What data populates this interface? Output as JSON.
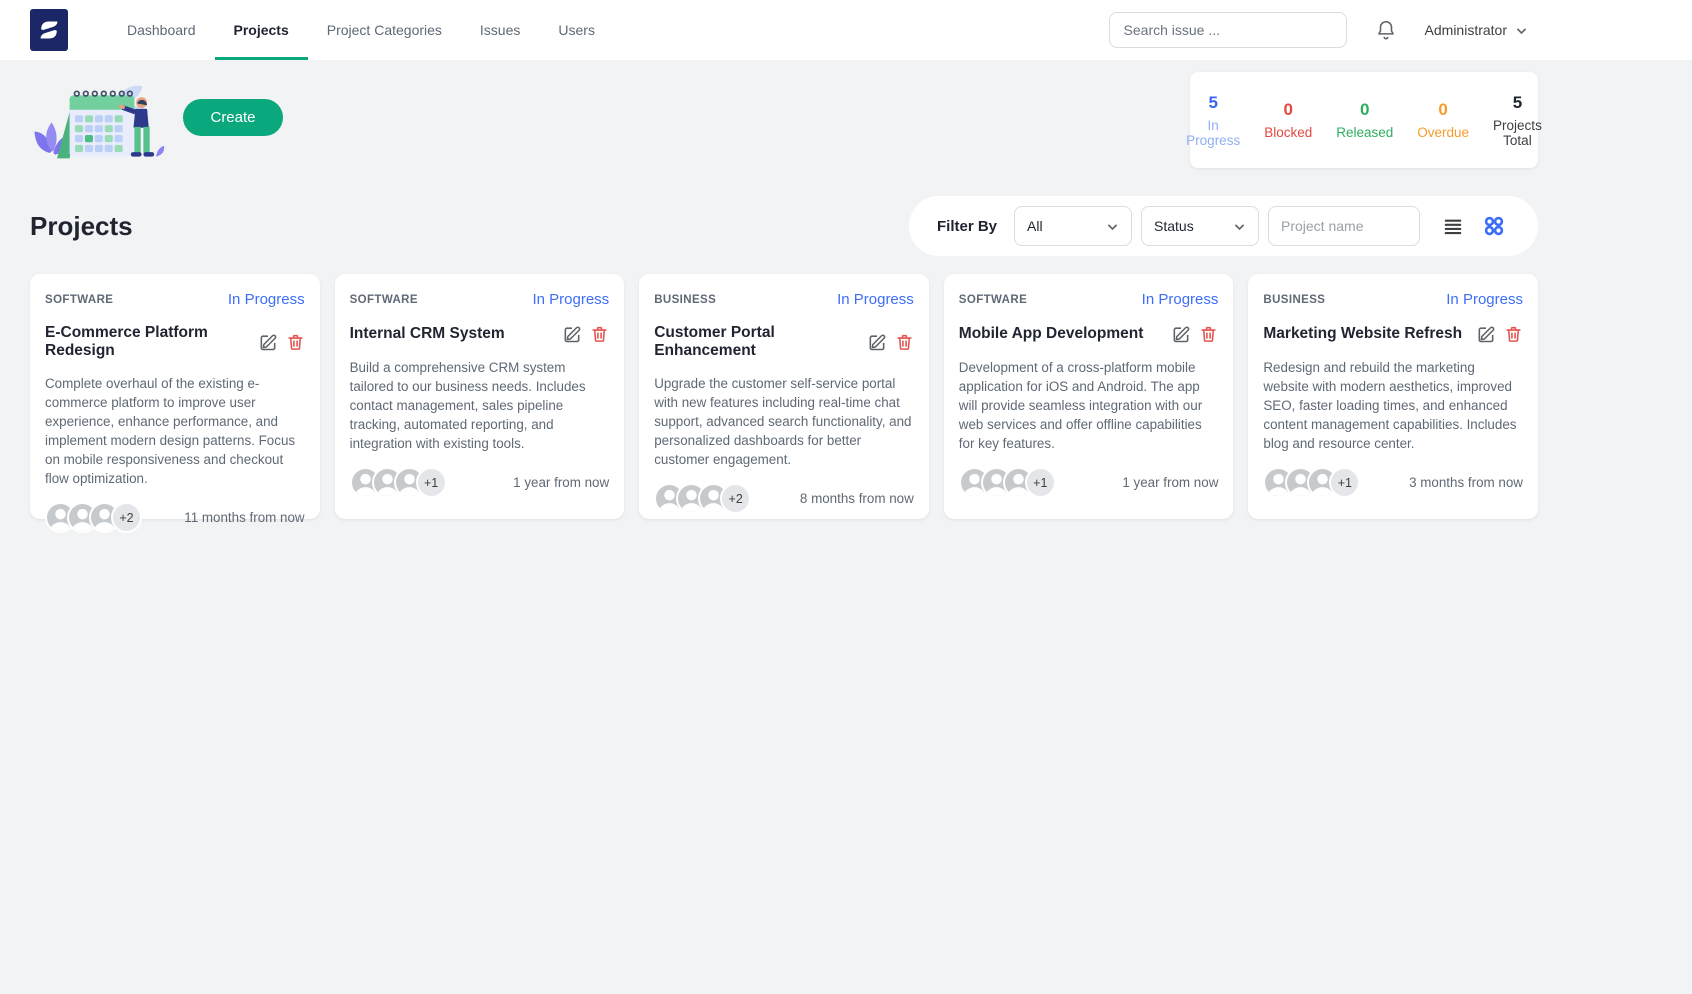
{
  "nav": {
    "items": [
      {
        "label": "Dashboard"
      },
      {
        "label": "Projects"
      },
      {
        "label": "Project Categories"
      },
      {
        "label": "Issues"
      },
      {
        "label": "Users"
      }
    ],
    "search_placeholder": "Search issue ...",
    "user_label": "Administrator"
  },
  "hero": {
    "create_label": "Create"
  },
  "stats": {
    "items": [
      {
        "value": "5",
        "label": "In Progress"
      },
      {
        "value": "0",
        "label": "Blocked"
      },
      {
        "value": "0",
        "label": "Released"
      },
      {
        "value": "0",
        "label": "Overdue"
      },
      {
        "value": "5",
        "label": "Projects Total"
      }
    ]
  },
  "main": {
    "title": "Projects",
    "filter": {
      "label": "Filter By",
      "category_value": "All",
      "status_value": "Status",
      "project_name_placeholder": "Project name"
    },
    "cards": [
      {
        "category": "SOFTWARE",
        "status": "In Progress",
        "title": "E-Commerce Platform Redesign",
        "description": "Complete overhaul of the existing e-commerce platform to improve user experience, enhance performance, and implement modern design patterns. Focus on mobile responsiveness and checkout flow optimization.",
        "extra": "+2",
        "due": "11 months from now"
      },
      {
        "category": "SOFTWARE",
        "status": "In Progress",
        "title": "Internal CRM System",
        "description": "Build a comprehensive CRM system tailored to our business needs. Includes contact management, sales pipeline tracking, automated reporting, and integration with existing tools.",
        "extra": "+1",
        "due": "1 year from now"
      },
      {
        "category": "BUSINESS",
        "status": "In Progress",
        "title": "Customer Portal Enhancement",
        "description": "Upgrade the customer self-service portal with new features including real-time chat support, advanced search functionality, and personalized dashboards for better customer engagement.",
        "extra": "+2",
        "due": "8 months from now"
      },
      {
        "category": "SOFTWARE",
        "status": "In Progress",
        "title": "Mobile App Development",
        "description": "Development of a cross-platform mobile application for iOS and Android. The app will provide seamless integration with our web services and offer offline capabilities for key features.",
        "extra": "+1",
        "due": "1 year from now"
      },
      {
        "category": "BUSINESS",
        "status": "In Progress",
        "title": "Marketing Website Refresh",
        "description": "Redesign and rebuild the marketing website with modern aesthetics, improved SEO, faster loading times, and enhanced content management capabilities. Includes blog and resource center.",
        "extra": "+1",
        "due": "3 months from now"
      }
    ]
  },
  "colors": {
    "brand_navy": "#1b2766",
    "accent_green": "#0ba77d",
    "status_blue": "#3d6ef7",
    "stat_in_progress": "#3d64f0",
    "stat_in_progress_label": "#8fb0f6",
    "stat_blocked": "#e5483f",
    "stat_released": "#2fae60",
    "stat_overdue": "#f59d2c",
    "danger_red": "#e25650",
    "grid_view_blue": "#3d6ef7"
  }
}
